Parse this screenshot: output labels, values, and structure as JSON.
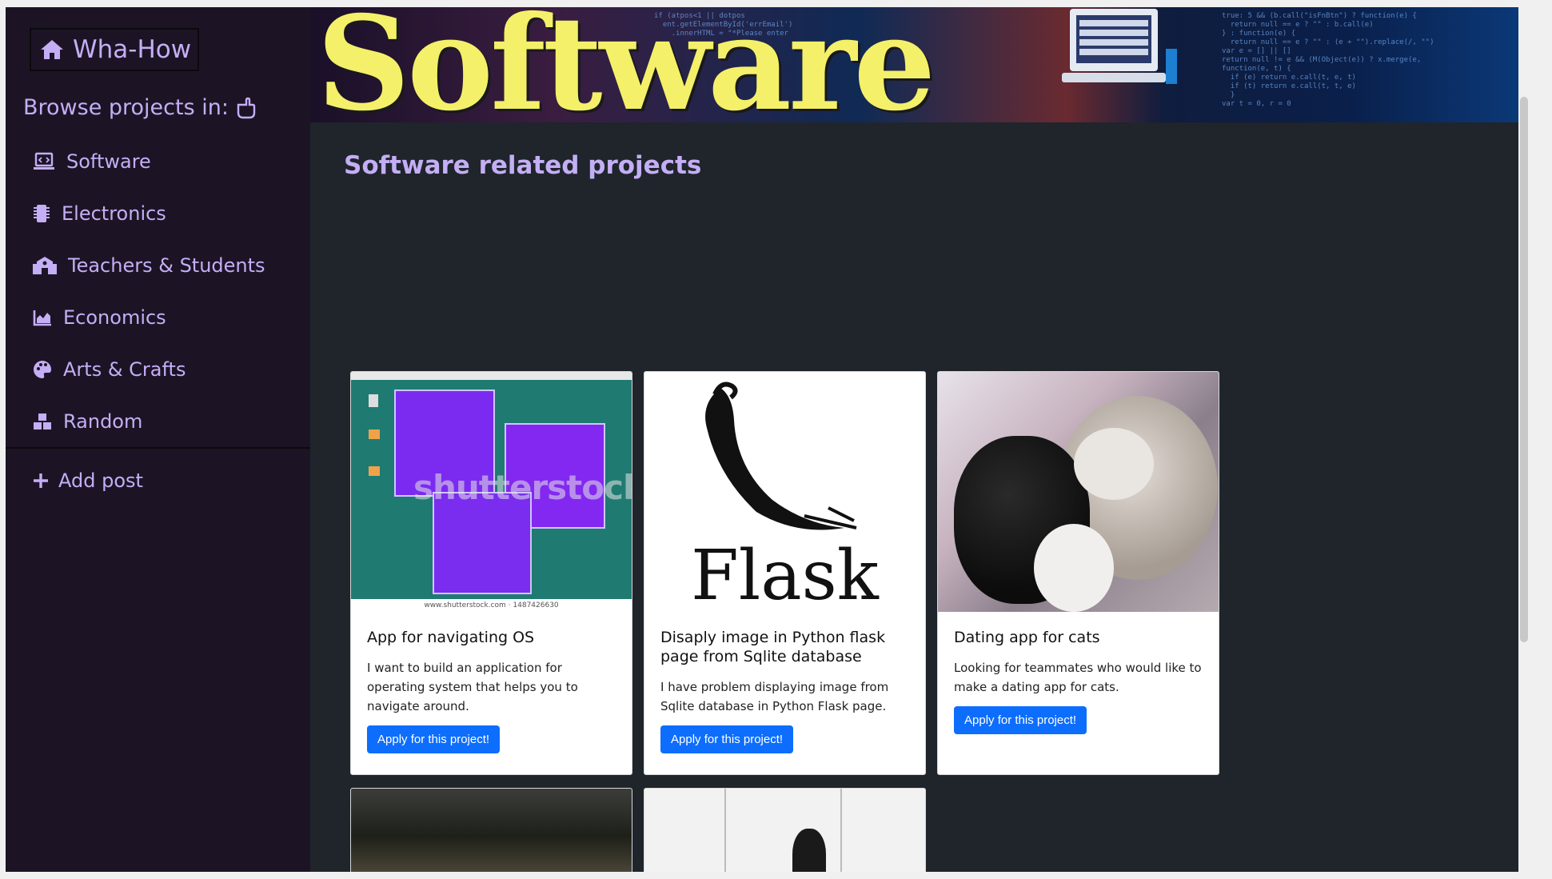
{
  "brand": {
    "label": "Wha-How",
    "icon": "home-icon"
  },
  "browse": {
    "label": "Browse projects in:",
    "icon": "hand-pointing-icon"
  },
  "nav": [
    {
      "label": "Software",
      "icon": "laptop-code-icon"
    },
    {
      "label": "Electronics",
      "icon": "microchip-icon"
    },
    {
      "label": "Teachers & Students",
      "icon": "school-icon"
    },
    {
      "label": "Economics",
      "icon": "chart-area-icon"
    },
    {
      "label": "Arts & Crafts",
      "icon": "palette-icon"
    },
    {
      "label": "Random",
      "icon": "cubes-icon"
    }
  ],
  "add_post": {
    "label": "Add post",
    "icon": "plus-icon"
  },
  "banner": {
    "word": "Software"
  },
  "main": {
    "title": "Software related projects"
  },
  "cards": [
    {
      "title": "App for navigating OS",
      "text": "I want to build an application for operating system that helps you to navigate around.",
      "button": "Apply for this project!",
      "image_watermark": "shutterstock",
      "image_caption": "www.shutterstock.com · 1487426630"
    },
    {
      "title": "Disaply image in Python flask page from Sqlite database",
      "text": "I have problem displaying image from Sqlite database in Python Flask page.",
      "button": "Apply for this project!",
      "image_logo_text": "Flask"
    },
    {
      "title": "Dating app for cats",
      "text": "Looking for teammates who would like to make a dating app for cats.",
      "button": "Apply for this project!"
    }
  ],
  "colors": {
    "accent": "#c4aef5",
    "sidebar_bg": "#1c1425",
    "main_bg": "#1f252b",
    "button": "#0d6efd"
  }
}
